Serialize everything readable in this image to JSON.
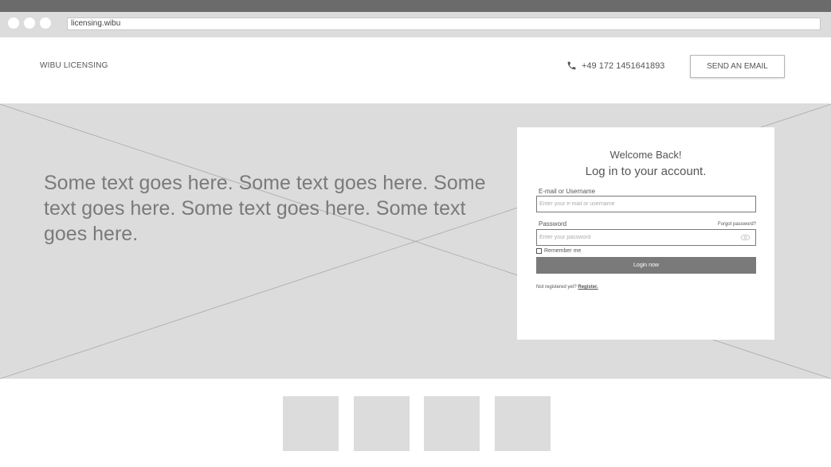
{
  "browser": {
    "url": "licensing.wibu"
  },
  "header": {
    "brand": "WIBU LICENSING",
    "phone": "+49 172 1451641893",
    "email_button": "SEND AN EMAIL"
  },
  "hero": {
    "text": "Some text goes here. Some text goes here. Some text goes here. Some text goes here. Some text goes here."
  },
  "login": {
    "welcome": "Welcome Back!",
    "title": "Log in to your account.",
    "email_label": "E-mail or Username",
    "email_placeholder": "Enter your e-mail or username",
    "password_label": "Password",
    "forgot": "Forgot password?",
    "password_placeholder": "Enter your password",
    "remember": "Remember me",
    "login_button": "Login now",
    "not_registered": "Not registered yet?",
    "register": "Register."
  },
  "colors": {
    "placeholder_gray": "#dcdcdc",
    "button_gray": "#7a7a7a",
    "chrome_dark": "#6b6b6b"
  },
  "icons": [
    "phone-icon",
    "eye-icon"
  ]
}
